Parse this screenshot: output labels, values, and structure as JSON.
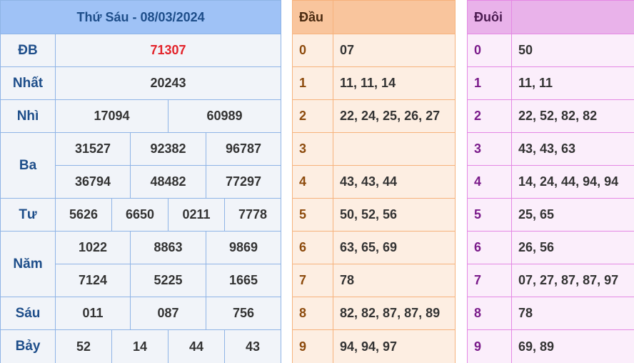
{
  "results": {
    "title": "Thứ Sáu - 08/03/2024",
    "prizes": {
      "db": {
        "label": "ĐB",
        "values": [
          "71307"
        ]
      },
      "nhat": {
        "label": "Nhất",
        "values": [
          "20243"
        ]
      },
      "nhi": {
        "label": "Nhì",
        "values": [
          "17094",
          "60989"
        ]
      },
      "ba": {
        "label": "Ba",
        "values": [
          "31527",
          "92382",
          "96787",
          "36794",
          "48482",
          "77297"
        ]
      },
      "tu": {
        "label": "Tư",
        "values": [
          "5626",
          "6650",
          "0211",
          "7778"
        ]
      },
      "nam": {
        "label": "Năm",
        "values": [
          "1022",
          "8863",
          "9869",
          "7124",
          "5225",
          "1665"
        ]
      },
      "sau": {
        "label": "Sáu",
        "values": [
          "011",
          "087",
          "756"
        ]
      },
      "bay": {
        "label": "Bảy",
        "values": [
          "52",
          "14",
          "44",
          "43"
        ]
      }
    },
    "colors": {
      "special_prize": "#e3232a",
      "header_bg": "#9fc2f6"
    }
  },
  "dau": {
    "header": "Đầu",
    "rows": [
      {
        "digit": "0",
        "values": "07"
      },
      {
        "digit": "1",
        "values": "11, 11, 14"
      },
      {
        "digit": "2",
        "values": "22, 24, 25, 26, 27"
      },
      {
        "digit": "3",
        "values": ""
      },
      {
        "digit": "4",
        "values": "43, 43, 44"
      },
      {
        "digit": "5",
        "values": "50, 52, 56"
      },
      {
        "digit": "6",
        "values": "63, 65, 69"
      },
      {
        "digit": "7",
        "values": "78"
      },
      {
        "digit": "8",
        "values": "82, 82, 87, 87, 89"
      },
      {
        "digit": "9",
        "values": "94, 94, 97"
      }
    ],
    "colors": {
      "header_bg": "#f9c59d",
      "row_bg": "#fdeee2"
    }
  },
  "duoi": {
    "header": "Đuôi",
    "rows": [
      {
        "digit": "0",
        "values": "50"
      },
      {
        "digit": "1",
        "values": "11, 11"
      },
      {
        "digit": "2",
        "values": "22, 52, 82, 82"
      },
      {
        "digit": "3",
        "values": "43, 43, 63"
      },
      {
        "digit": "4",
        "values": "14, 24, 44, 94, 94"
      },
      {
        "digit": "5",
        "values": "25, 65"
      },
      {
        "digit": "6",
        "values": "26, 56"
      },
      {
        "digit": "7",
        "values": "07, 27, 87, 87, 97"
      },
      {
        "digit": "8",
        "values": "78"
      },
      {
        "digit": "9",
        "values": "69, 89"
      }
    ],
    "colors": {
      "header_bg": "#e9b2ea",
      "row_bg": "#fbeefb"
    }
  }
}
